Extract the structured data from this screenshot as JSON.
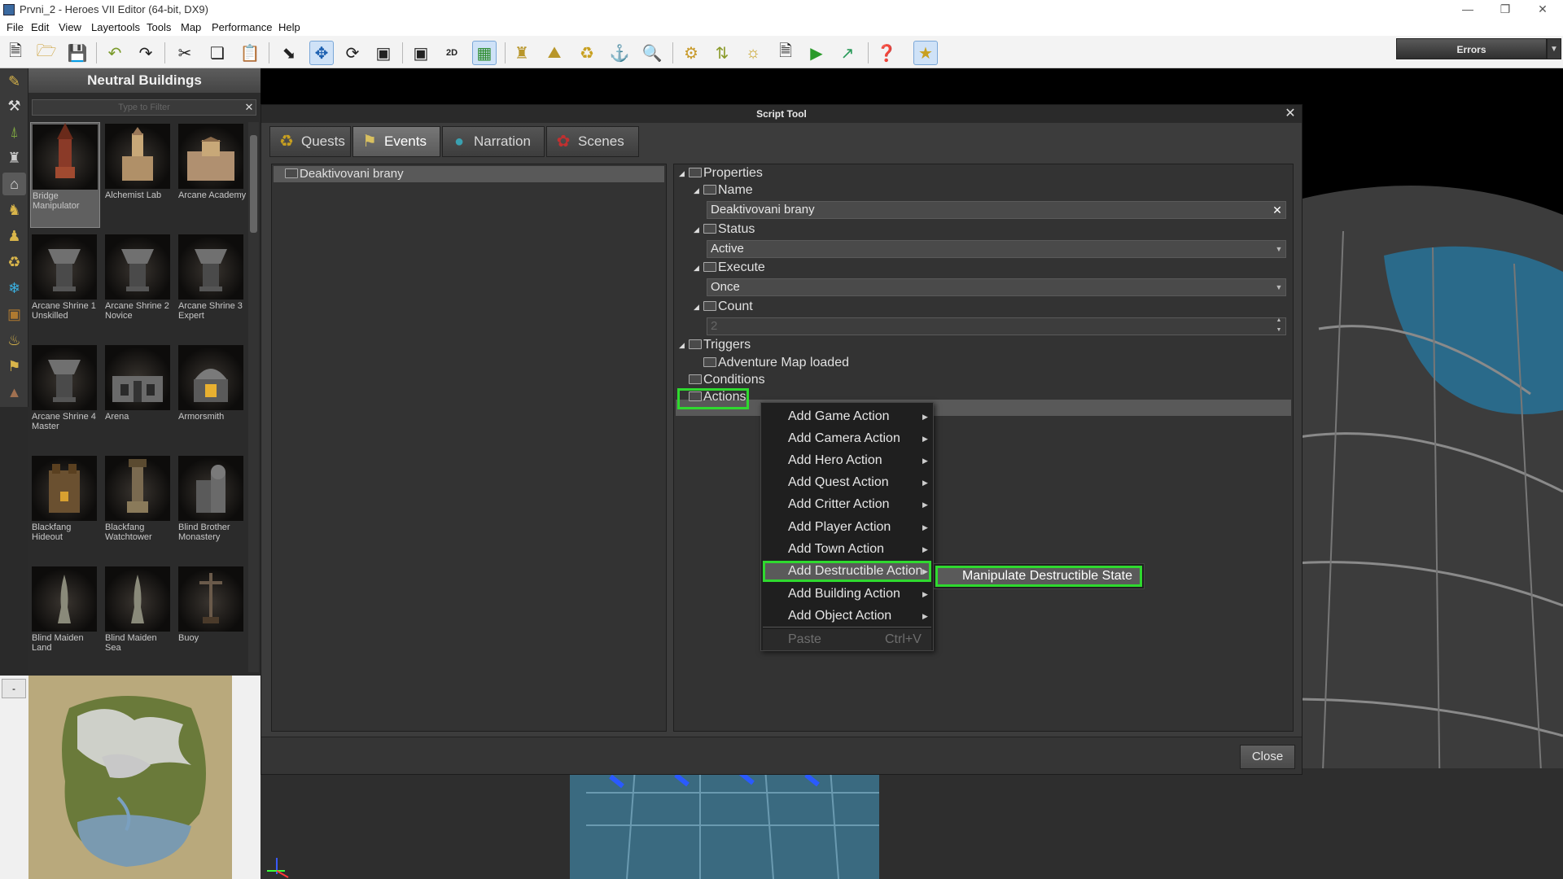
{
  "window": {
    "title": "Prvni_2 - Heroes VII Editor (64-bit, DX9)"
  },
  "menu": [
    "File",
    "Edit",
    "View",
    "Layertools",
    "Tools",
    "Map",
    "Performance",
    "Help"
  ],
  "errors_label": "Errors",
  "panel": {
    "title": "Neutral Buildings",
    "filter_placeholder": "Type to Filter",
    "items": [
      {
        "label": "Bridge Manipulator"
      },
      {
        "label": "Alchemist Lab"
      },
      {
        "label": "Arcane Academy"
      },
      {
        "label": "Arcane Shrine 1 Unskilled"
      },
      {
        "label": "Arcane Shrine 2 Novice"
      },
      {
        "label": "Arcane Shrine 3 Expert"
      },
      {
        "label": "Arcane Shrine 4 Master"
      },
      {
        "label": "Arena"
      },
      {
        "label": "Armorsmith"
      },
      {
        "label": "Blackfang Hideout"
      },
      {
        "label": "Blackfang Watchtower"
      },
      {
        "label": "Blind Brother Monastery"
      },
      {
        "label": "Blind Maiden Land"
      },
      {
        "label": "Blind Maiden Sea"
      },
      {
        "label": "Buoy"
      }
    ],
    "minimap_button": "-"
  },
  "script_tool": {
    "title": "Script Tool",
    "tabs": [
      {
        "label": "Quests",
        "icon": "chalice-icon"
      },
      {
        "label": "Events",
        "icon": "flag-icon"
      },
      {
        "label": "Narration",
        "icon": "speech-icon"
      },
      {
        "label": "Scenes",
        "icon": "scene-icon"
      }
    ],
    "event_name": "Deaktivovani brany",
    "properties": {
      "root": "Properties",
      "name_label": "Name",
      "name_value": "Deaktivovani brany",
      "status_label": "Status",
      "status_value": "Active",
      "execute_label": "Execute",
      "execute_value": "Once",
      "count_label": "Count",
      "count_value": "2",
      "triggers_label": "Triggers",
      "trigger_item": "Adventure Map loaded",
      "conditions_label": "Conditions",
      "actions_label": "Actions"
    },
    "close_label": "Close"
  },
  "context_menu": {
    "items": [
      {
        "label": "Add Game Action"
      },
      {
        "label": "Add Camera Action"
      },
      {
        "label": "Add Hero Action"
      },
      {
        "label": "Add Quest Action"
      },
      {
        "label": "Add Critter Action"
      },
      {
        "label": "Add Player Action"
      },
      {
        "label": "Add Town Action"
      },
      {
        "label": "Add Destructible Action"
      },
      {
        "label": "Add Building Action"
      },
      {
        "label": "Add Object Action"
      }
    ],
    "paste_label": "Paste",
    "paste_shortcut": "Ctrl+V",
    "submenu_item": "Manipulate Destructible State"
  },
  "colors": {
    "highlight": "#2fd92f",
    "panel_bg": "#3c3c3c"
  }
}
